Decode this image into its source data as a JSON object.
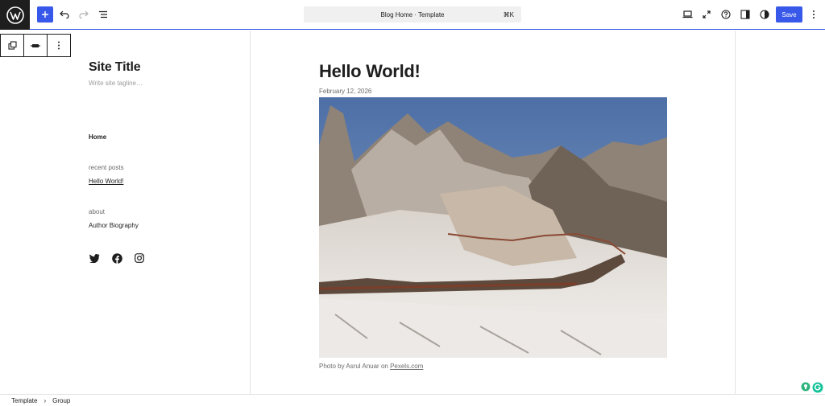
{
  "header": {
    "document_title": "Blog Home · Template",
    "shortcut": "⌘K",
    "save_label": "Save",
    "accent_color": "#3858e9",
    "icons": [
      "wordpress-logo",
      "plus-icon",
      "undo-icon",
      "redo-icon",
      "list-view-icon",
      "desktop-view-icon",
      "fullscreen-icon",
      "help-icon",
      "sidebar-icon",
      "styles-icon",
      "more-options-icon"
    ]
  },
  "block_toolbar": {
    "icons": [
      "duplicate-icon",
      "align-icon",
      "more-vertical-icon"
    ]
  },
  "sidebar": {
    "site_title": "Site Title",
    "tagline_placeholder": "Write site tagline…",
    "nav_home": "Home",
    "recent_posts_label": "recent posts",
    "recent_post_link": "Hello World!",
    "about_label": "about",
    "author_link": "Author Biography",
    "social_icons": [
      "twitter-icon",
      "facebook-icon",
      "instagram-icon"
    ]
  },
  "post": {
    "title": "Hello World!",
    "date": "February 12, 2026",
    "caption_prefix": "Photo by Asrul Anuar on ",
    "caption_link": "Pexels.com"
  },
  "footer": {
    "breadcrumbs": [
      "Template",
      "Group"
    ]
  }
}
